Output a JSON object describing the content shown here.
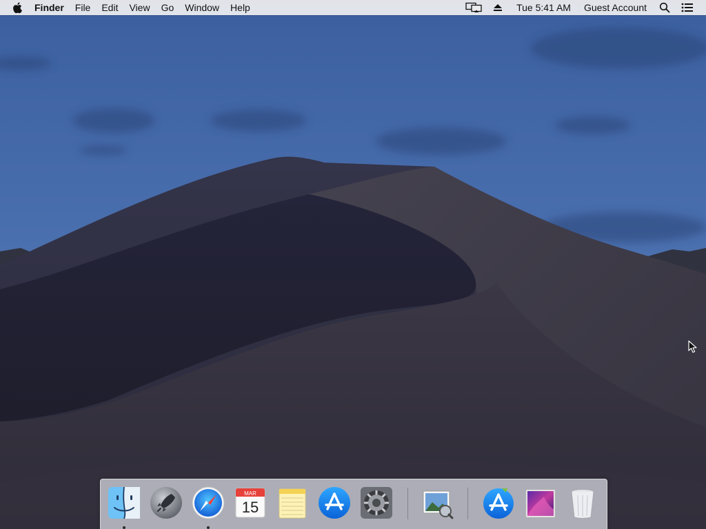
{
  "menubar": {
    "apple_icon": "apple-logo-icon",
    "app_name": "Finder",
    "menus": [
      "File",
      "Edit",
      "View",
      "Go",
      "Window",
      "Help"
    ],
    "status_icons": [
      "airplay-display-icon",
      "eject-icon"
    ],
    "clock": "Tue 5:41 AM",
    "user": "Guest Account",
    "right_icons": [
      "spotlight-search-icon",
      "notification-center-icon"
    ]
  },
  "dock": {
    "items": [
      {
        "name": "Finder",
        "icon": "finder-icon",
        "running": true
      },
      {
        "name": "Launchpad",
        "icon": "launchpad-rocket-icon",
        "running": false
      },
      {
        "name": "Safari",
        "icon": "safari-compass-icon",
        "running": true
      },
      {
        "name": "Calendar",
        "icon": "calendar-icon",
        "running": false,
        "month": "MAR",
        "day": "15"
      },
      {
        "name": "Notes",
        "icon": "notes-icon",
        "running": false
      },
      {
        "name": "App Store",
        "icon": "app-store-icon",
        "running": false
      },
      {
        "name": "System Preferences",
        "icon": "system-preferences-gear-icon",
        "running": false
      },
      {
        "name": "Preview",
        "icon": "preview-photos-icon",
        "running": false
      },
      {
        "name": "Install macOS",
        "icon": "app-store-download-icon",
        "running": false
      },
      {
        "name": "macOS Wallpaper",
        "icon": "wallpaper-image-icon",
        "running": false
      },
      {
        "name": "Trash",
        "icon": "trash-icon",
        "running": false
      }
    ]
  },
  "colors": {
    "sky_top": "#3e63a5",
    "sky_horizon": "#6a8ab8",
    "dune_shadow": "#262636",
    "dune_light": "#3d3a4a",
    "menubar_bg": "#ececee",
    "dock_bg": "#ced1d8"
  },
  "cursor": "arrow-pointer-icon"
}
